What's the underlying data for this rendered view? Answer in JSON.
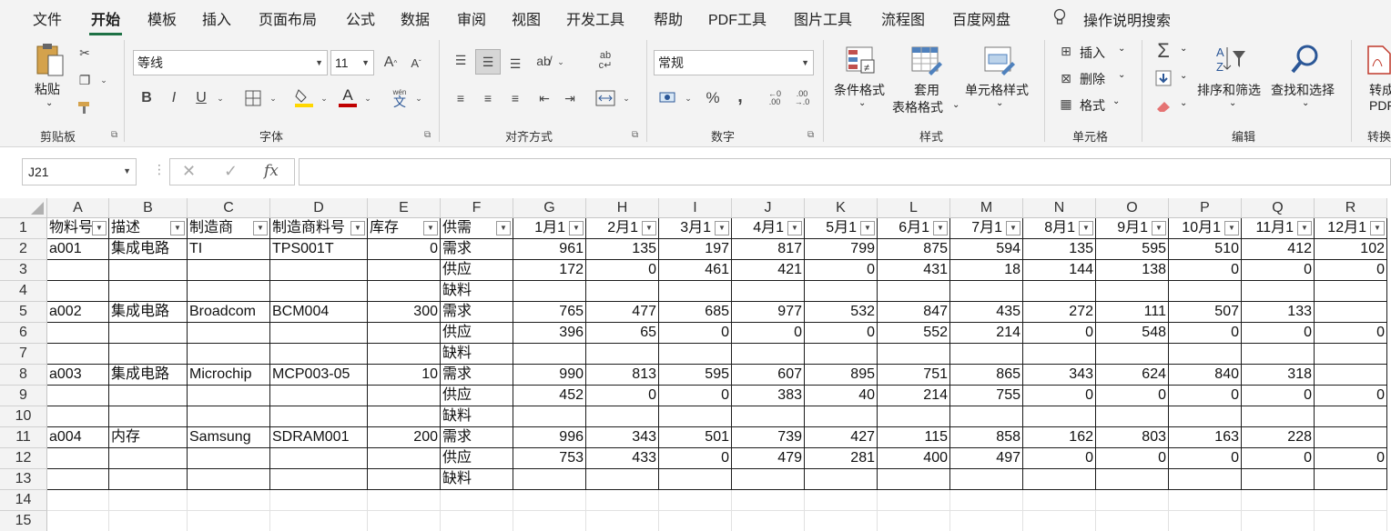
{
  "tabs": [
    "文件",
    "开始",
    "模板",
    "插入",
    "页面布局",
    "公式",
    "数据",
    "审阅",
    "视图",
    "开发工具",
    "帮助",
    "PDF工具",
    "图片工具",
    "流程图",
    "百度网盘"
  ],
  "active_tab": "开始",
  "search": {
    "label": "操作说明搜索",
    "icon": "lightbulb-icon"
  },
  "clipboard": {
    "paste": "粘贴",
    "group": "剪贴板"
  },
  "font": {
    "name": "等线",
    "size": "11",
    "bold": "B",
    "italic": "I",
    "underline": "U",
    "grow": "A",
    "shrink": "A",
    "color_letter": "A",
    "phonetic": "wén",
    "group": "字体",
    "fill_color": "#ffd700",
    "font_color": "#c00000"
  },
  "alignment": {
    "group": "对齐方式"
  },
  "number": {
    "format": "常规",
    "percent": "%",
    "comma": ",",
    "group": "数字"
  },
  "styles": {
    "conditional": "条件格式",
    "table_line1": "套用",
    "table_line2": "表格格式",
    "cell_styles": "单元格样式",
    "group": "样式"
  },
  "cells": {
    "insert": "插入",
    "delete": "删除",
    "format": "格式",
    "group": "单元格"
  },
  "editing": {
    "sort": "排序和筛选",
    "find": "查找和选择",
    "group": "编辑"
  },
  "convert": {
    "line1": "转成",
    "line2": "PDF",
    "group": "转换"
  },
  "formula_bar": {
    "name_box": "J21",
    "cancel": "✕",
    "enter": "✓",
    "fx": "fx",
    "value": ""
  },
  "columns": [
    "A",
    "B",
    "C",
    "D",
    "E",
    "F",
    "G",
    "H",
    "I",
    "J",
    "K",
    "L",
    "M",
    "N",
    "O",
    "P",
    "Q",
    "R"
  ],
  "row_numbers": [
    "1",
    "2",
    "3",
    "4",
    "5",
    "6",
    "7",
    "8",
    "9",
    "10",
    "11",
    "12",
    "13",
    "14",
    "15"
  ],
  "header_row": [
    "物料号",
    "描述",
    "制造商",
    "制造商料号",
    "库存",
    "供需",
    "1月1",
    "2月1",
    "3月1",
    "4月1",
    "5月1",
    "6月1",
    "7月1",
    "8月1",
    "9月1",
    "10月1",
    "11月1",
    "12月1"
  ],
  "rows": [
    [
      "a001",
      "集成电路",
      "TI",
      "TPS001T",
      "0",
      "需求",
      "961",
      "135",
      "197",
      "817",
      "799",
      "875",
      "594",
      "135",
      "595",
      "510",
      "412",
      "102"
    ],
    [
      "",
      "",
      "",
      "",
      "",
      "供应",
      "172",
      "0",
      "461",
      "421",
      "0",
      "431",
      "18",
      "144",
      "138",
      "0",
      "0",
      "0"
    ],
    [
      "",
      "",
      "",
      "",
      "",
      "缺料",
      "",
      "",
      "",
      "",
      "",
      "",
      "",
      "",
      "",
      "",
      "",
      ""
    ],
    [
      "a002",
      "集成电路",
      "Broadcom",
      "BCM004",
      "300",
      "需求",
      "765",
      "477",
      "685",
      "977",
      "532",
      "847",
      "435",
      "272",
      "111",
      "507",
      "133",
      ""
    ],
    [
      "",
      "",
      "",
      "",
      "",
      "供应",
      "396",
      "65",
      "0",
      "0",
      "0",
      "552",
      "214",
      "0",
      "548",
      "0",
      "0",
      "0"
    ],
    [
      "",
      "",
      "",
      "",
      "",
      "缺料",
      "",
      "",
      "",
      "",
      "",
      "",
      "",
      "",
      "",
      "",
      "",
      ""
    ],
    [
      "a003",
      "集成电路",
      "Microchip",
      "MCP003-05",
      "10",
      "需求",
      "990",
      "813",
      "595",
      "607",
      "895",
      "751",
      "865",
      "343",
      "624",
      "840",
      "318",
      ""
    ],
    [
      "",
      "",
      "",
      "",
      "",
      "供应",
      "452",
      "0",
      "0",
      "383",
      "40",
      "214",
      "755",
      "0",
      "0",
      "0",
      "0",
      "0"
    ],
    [
      "",
      "",
      "",
      "",
      "",
      "缺料",
      "",
      "",
      "",
      "",
      "",
      "",
      "",
      "",
      "",
      "",
      "",
      ""
    ],
    [
      "a004",
      "内存",
      "Samsung",
      "SDRAM001",
      "200",
      "需求",
      "996",
      "343",
      "501",
      "739",
      "427",
      "115",
      "858",
      "162",
      "803",
      "163",
      "228",
      ""
    ],
    [
      "",
      "",
      "",
      "",
      "",
      "供应",
      "753",
      "433",
      "0",
      "479",
      "281",
      "400",
      "497",
      "0",
      "0",
      "0",
      "0",
      "0"
    ],
    [
      "",
      "",
      "",
      "",
      "",
      "缺料",
      "",
      "",
      "",
      "",
      "",
      "",
      "",
      "",
      "",
      "",
      "",
      ""
    ],
    [
      "",
      "",
      "",
      "",
      "",
      "",
      "",
      "",
      "",
      "",
      "",
      "",
      "",
      "",
      "",
      "",
      "",
      ""
    ],
    [
      "",
      "",
      "",
      "",
      "",
      "",
      "",
      "",
      "",
      "",
      "",
      "",
      "",
      "",
      "",
      "",
      "",
      ""
    ]
  ]
}
